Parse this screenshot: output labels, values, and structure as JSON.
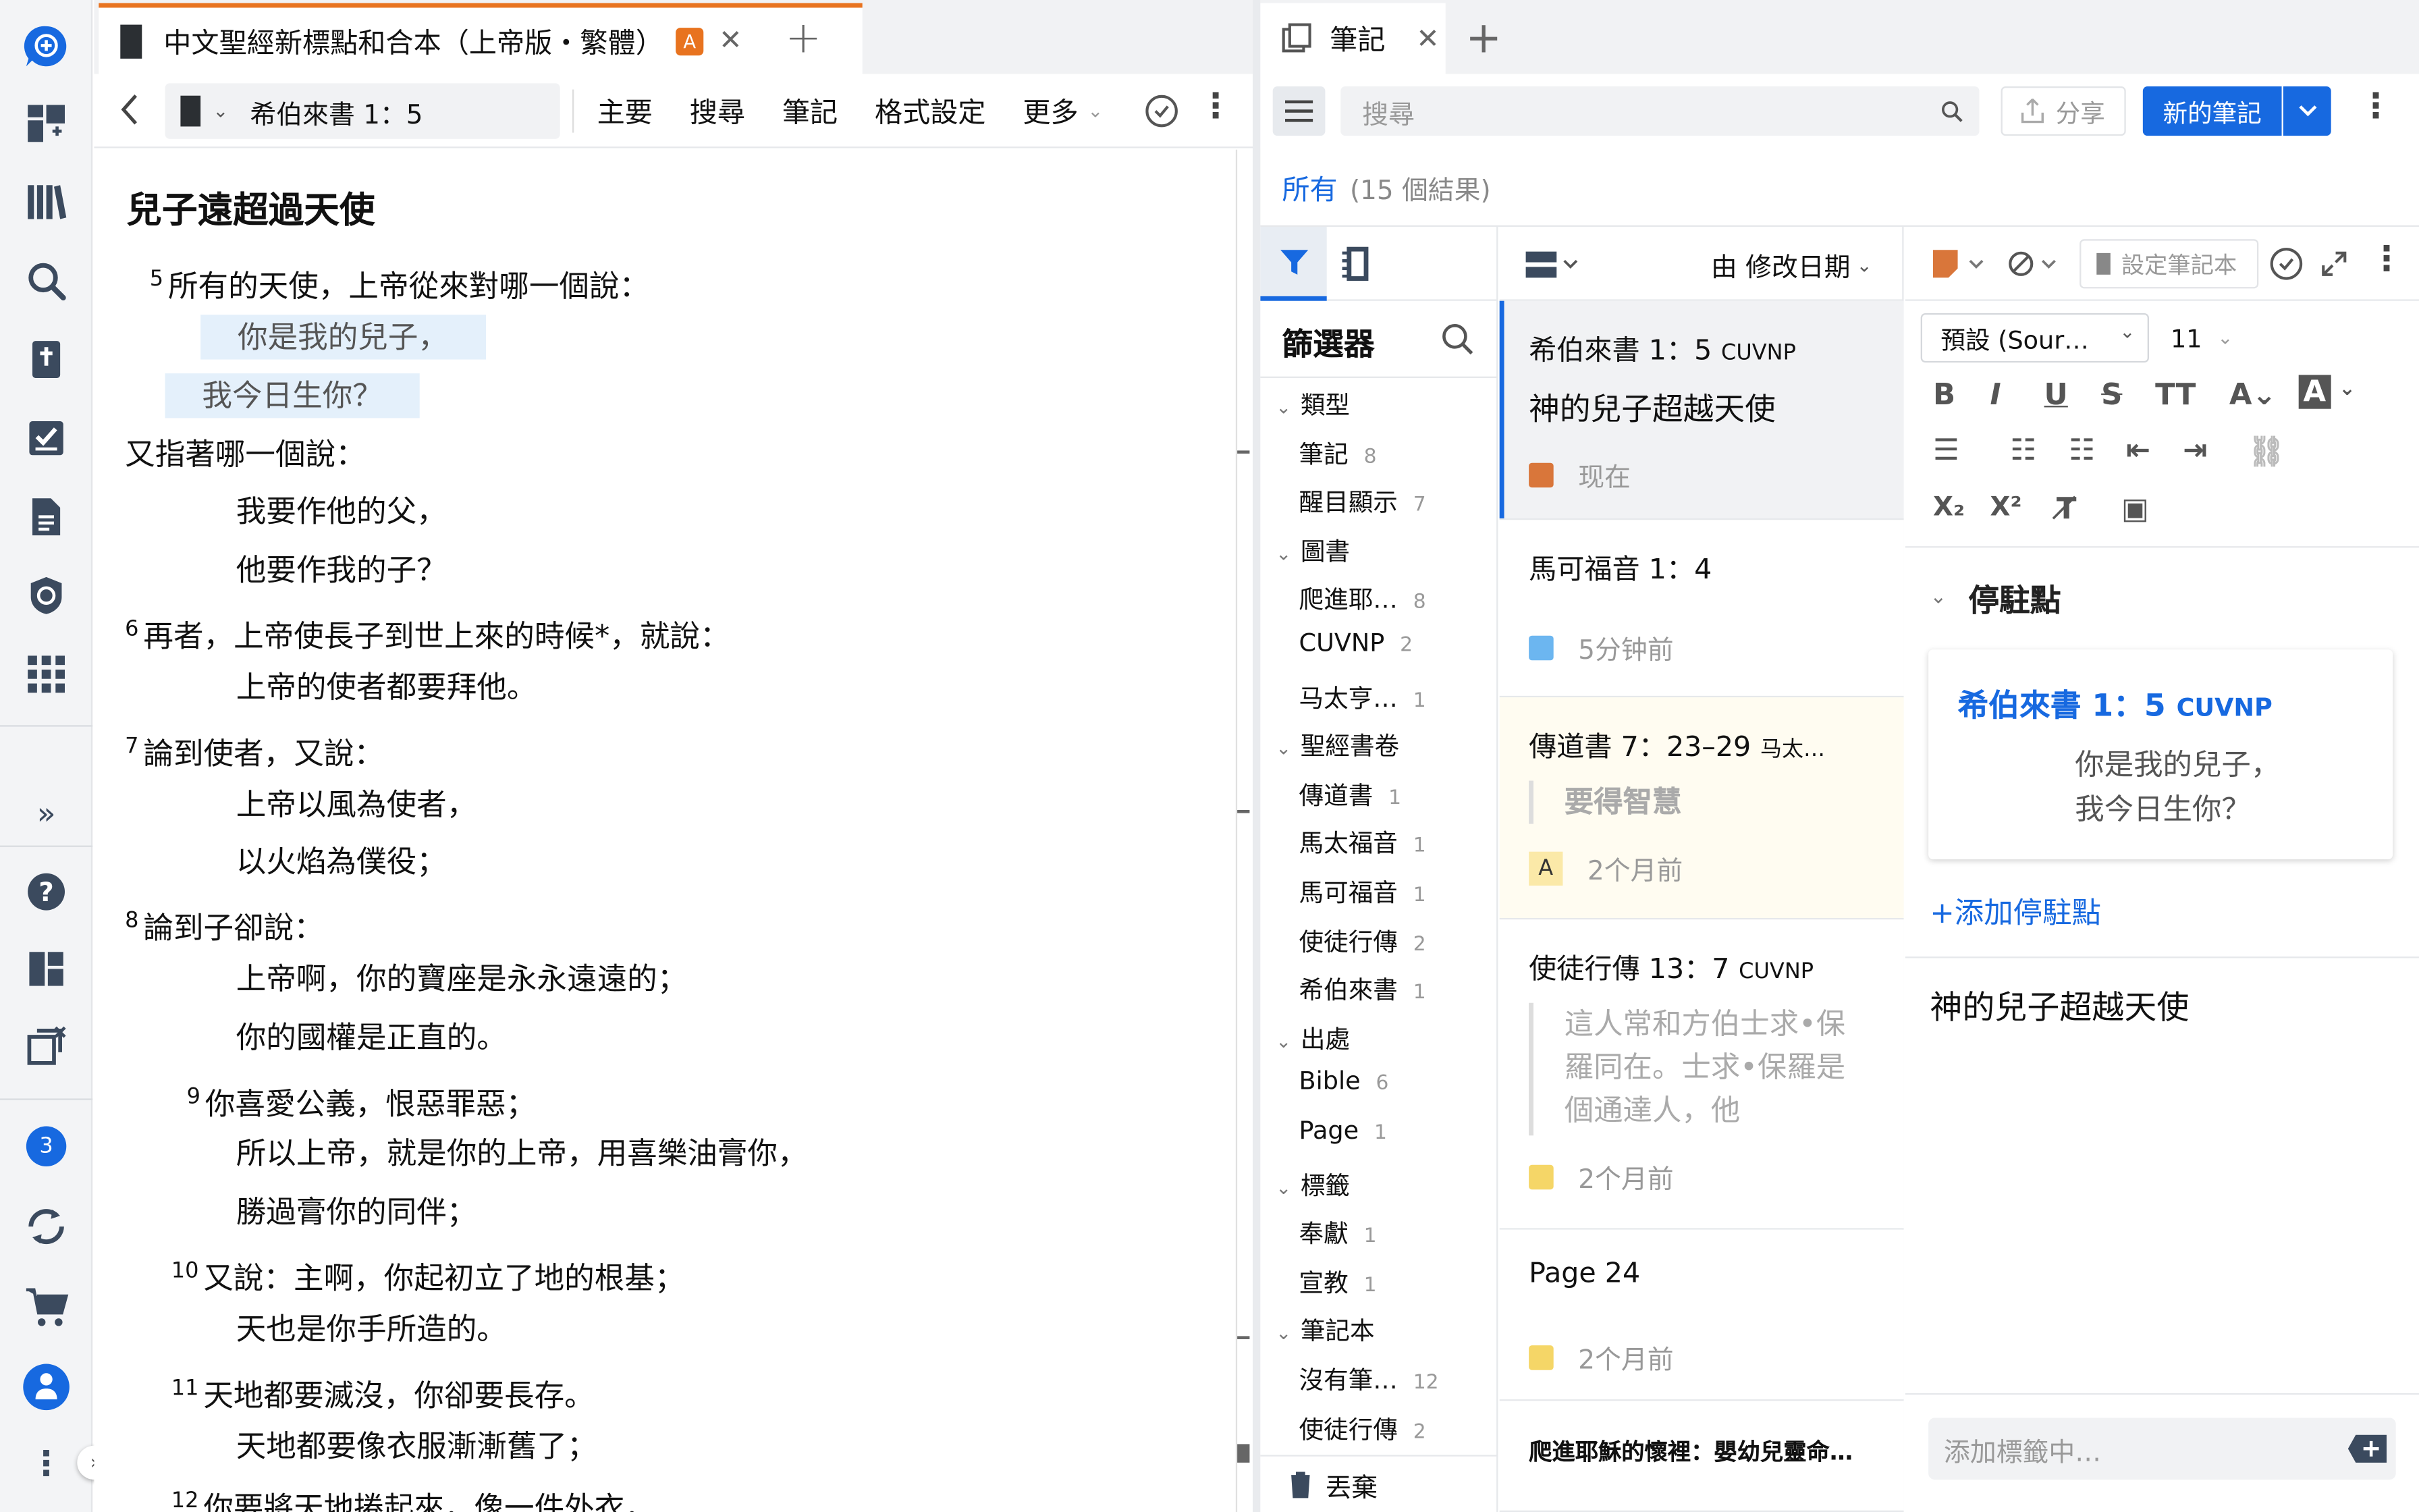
{
  "bible": {
    "tab_title": "中文聖經新標點和合本（上帝版・繁體）",
    "tab_badge": "A",
    "reference": "希伯來書 1：5",
    "menu": [
      "主要",
      "搜尋",
      "筆記",
      "格式設定",
      "更多"
    ],
    "heading": "兒子遠超過天使",
    "lines": [
      {
        "num": "5",
        "text": "所有的天使，上帝從來對哪一個說：",
        "highlight": false
      },
      {
        "num": "",
        "text": "你是我的兒子，",
        "highlight": true
      },
      {
        "num": "",
        "text": "我今日生你？",
        "highlight": true
      },
      {
        "num": "",
        "text": "又指著哪一個說：",
        "highlight": false
      },
      {
        "num": "",
        "text": "我要作他的父，",
        "highlight": false
      },
      {
        "num": "",
        "text": "他要作我的子？",
        "highlight": false
      },
      {
        "num": "6",
        "text": "再者，上帝使長子到世上來的時候*，就說：",
        "highlight": false
      },
      {
        "num": "",
        "text": "上帝的使者都要拜他。",
        "highlight": false
      },
      {
        "num": "7",
        "text": "論到使者，又說：",
        "highlight": false
      },
      {
        "num": "",
        "text": "上帝以風為使者，",
        "highlight": false
      },
      {
        "num": "",
        "text": "以火焰為僕役；",
        "highlight": false
      },
      {
        "num": "8",
        "text": "論到子卻說：",
        "highlight": false
      },
      {
        "num": "",
        "text": "上帝啊，你的寶座是永永遠遠的；",
        "highlight": false
      },
      {
        "num": "",
        "text": "你的國權是正直的。",
        "highlight": false
      },
      {
        "num": "9",
        "text": "你喜愛公義，恨惡罪惡；",
        "highlight": false
      },
      {
        "num": "",
        "text": "所以上帝，就是你的上帝，用喜樂油膏你，",
        "highlight": false
      },
      {
        "num": "",
        "text": "勝過膏你的同伴；",
        "highlight": false
      },
      {
        "num": "10",
        "text": "又說：主啊，你起初立了地的根基；",
        "highlight": false
      },
      {
        "num": "",
        "text": "天也是你手所造的。",
        "highlight": false
      },
      {
        "num": "11",
        "text": "天地都要滅沒，你卻要長存。",
        "highlight": false
      },
      {
        "num": "",
        "text": "天地都要像衣服漸漸舊了；",
        "highlight": false
      },
      {
        "num": "12",
        "text": "你要將天地捲起來，像一件外衣，",
        "highlight": false
      }
    ]
  },
  "notes": {
    "tab_title": "筆記",
    "search_placeholder": "搜尋",
    "share_label": "分享",
    "new_note_label": "新的筆記",
    "all_label": "所有",
    "result_count": "(15 個結果)",
    "sort_label": "由 修改日期",
    "filter_title": "篩選器",
    "filter_groups": [
      {
        "label": "類型",
        "items": [
          {
            "label": "筆記",
            "count": "8"
          },
          {
            "label": "醒目顯示",
            "count": "7"
          }
        ]
      },
      {
        "label": "圖書",
        "items": [
          {
            "label": "爬進耶…",
            "count": "8"
          },
          {
            "label": "CUVNP",
            "count": "2"
          },
          {
            "label": "马太亨…",
            "count": "1"
          }
        ]
      },
      {
        "label": "聖經書卷",
        "items": [
          {
            "label": "傳道書",
            "count": "1"
          },
          {
            "label": "馬太福音",
            "count": "1"
          },
          {
            "label": "馬可福音",
            "count": "1"
          },
          {
            "label": "使徒行傳",
            "count": "2"
          },
          {
            "label": "希伯來書",
            "count": "1"
          }
        ]
      },
      {
        "label": "出處",
        "items": [
          {
            "label": "Bible",
            "count": "6"
          },
          {
            "label": "Page",
            "count": "1"
          }
        ]
      },
      {
        "label": "標籤",
        "items": [
          {
            "label": "奉獻",
            "count": "1"
          },
          {
            "label": "宣教",
            "count": "1"
          }
        ]
      },
      {
        "label": "筆記本",
        "items": [
          {
            "label": "沒有筆…",
            "count": "12"
          },
          {
            "label": "使徒行傳",
            "count": "2"
          }
        ]
      }
    ],
    "trash_label": "丟棄",
    "cards": [
      {
        "title": "希伯來書 1：5",
        "version": "CUVNP",
        "subtitle": "神的兒子超越天使",
        "time": "现在"
      },
      {
        "title": "馬可福音 1：4",
        "time": "5分钟前"
      },
      {
        "title": "傳道書 7：23–29",
        "version": "马太…",
        "quote": "要得智慧",
        "badge": "A",
        "time": "2个月前"
      },
      {
        "title": "使徒行傳 13：7",
        "version": "CUVNP",
        "quote": "這人常和方伯士求•保羅同在。士求•保羅是個通達人，他",
        "time": "2个月前"
      },
      {
        "title": "Page 24",
        "time": "2个月前"
      },
      {
        "title": "爬進耶穌的懷裡：嬰幼兒靈命…"
      }
    ],
    "editor": {
      "notebook_placeholder": "設定筆記本",
      "font_name": "預設 (Sour…",
      "font_size": "11",
      "anchors_label": "停駐點",
      "anchor_ref": "希伯來書 1：5",
      "anchor_version": "CUVNP",
      "anchor_lines": [
        "你是我的兒子，",
        "我今日生你？"
      ],
      "add_anchor": "+添加停駐點",
      "body": "神的兒子超越天使",
      "tag_placeholder": "添加標籤中…"
    }
  },
  "rail": {
    "badge": "3"
  },
  "colors": {
    "accent": "#1769e0",
    "highlight": "#e4f0fb",
    "tab_indicator": "#e8731f"
  }
}
